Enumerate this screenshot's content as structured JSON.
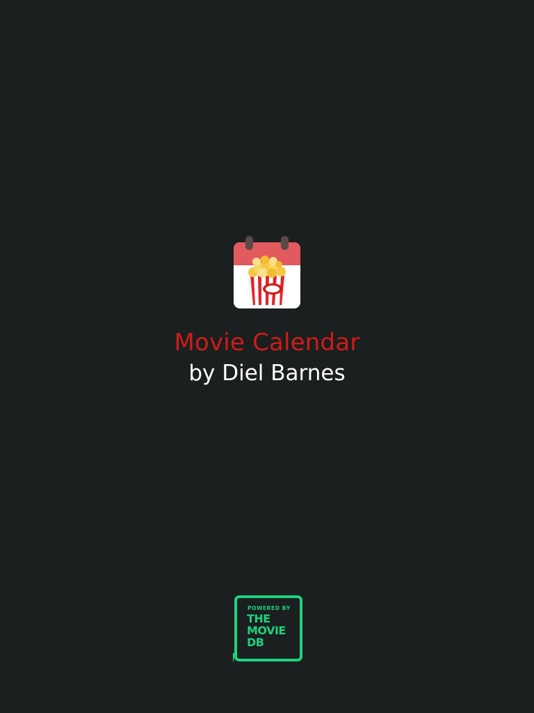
{
  "app": {
    "title": "Movie Calendar",
    "author": "by Diel Barnes",
    "icon": "popcorn-calendar-icon"
  },
  "attribution": {
    "powered_by": "POWERED BY",
    "line1": "THE",
    "line2": "MOVIE",
    "line3": "DB",
    "icon": "tmdb-logo-icon"
  },
  "colors": {
    "background": "#1b1f20",
    "title": "#d11b17",
    "author": "#ffffff",
    "tmdb_green": "#1ed27d",
    "calendar_red": "#e05a5e"
  }
}
